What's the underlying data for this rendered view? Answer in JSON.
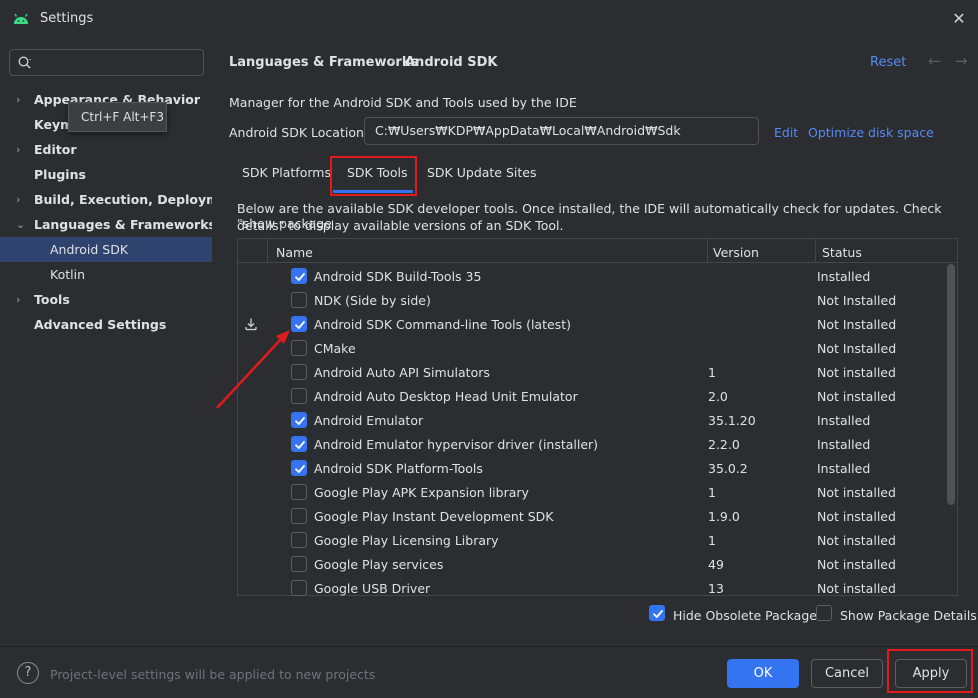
{
  "window": {
    "title": "Settings",
    "close_icon": "close-icon"
  },
  "sidebar": {
    "search_placeholder": "",
    "tooltip": "Ctrl+F Alt+F3",
    "items": [
      {
        "label": "Appearance & Behavior",
        "expandable": true
      },
      {
        "label": "Keymap",
        "expandable": false
      },
      {
        "label": "Editor",
        "expandable": true
      },
      {
        "label": "Plugins",
        "expandable": false
      },
      {
        "label": "Build, Execution, Deployment",
        "expandable": true
      },
      {
        "label": "Languages & Frameworks",
        "expandable": true,
        "expanded": true
      },
      {
        "label": "Android SDK",
        "sub": true,
        "selected": true
      },
      {
        "label": "Kotlin",
        "sub": true
      },
      {
        "label": "Tools",
        "expandable": true
      },
      {
        "label": "Advanced Settings",
        "expandable": false
      }
    ]
  },
  "header": {
    "breadcrumb_1": "Languages & Frameworks",
    "breadcrumb_sep": "›",
    "breadcrumb_2": "Android SDK",
    "reset": "Reset",
    "back": "←",
    "forward": "→"
  },
  "main": {
    "description": "Manager for the Android SDK and Tools used by the IDE",
    "location_label": "Android SDK Location:",
    "location_value": "C:₩Users₩KDP₩AppData₩Local₩Android₩Sdk",
    "edit": "Edit",
    "optimize": "Optimize disk space",
    "tabs": [
      {
        "label": "SDK Platforms"
      },
      {
        "label": "SDK Tools",
        "active": true
      },
      {
        "label": "SDK Update Sites"
      }
    ],
    "hint_line_1": "Below are the available SDK developer tools. Once installed, the IDE will automatically check for updates. Check \"show package",
    "hint_line_2": "details\" to display available versions of an SDK Tool.",
    "table": {
      "columns": [
        "Name",
        "Version",
        "Status"
      ],
      "rows": [
        {
          "checked": true,
          "name": "Android SDK Build-Tools 35",
          "version": "",
          "status": "Installed",
          "download": false
        },
        {
          "checked": false,
          "name": "NDK (Side by side)",
          "version": "",
          "status": "Not Installed",
          "download": false
        },
        {
          "checked": true,
          "name": "Android SDK Command-line Tools (latest)",
          "version": "",
          "status": "Not Installed",
          "download": true
        },
        {
          "checked": false,
          "name": "CMake",
          "version": "",
          "status": "Not Installed",
          "download": false
        },
        {
          "checked": false,
          "name": "Android Auto API Simulators",
          "version": "1",
          "status": "Not installed",
          "download": false
        },
        {
          "checked": false,
          "name": "Android Auto Desktop Head Unit Emulator",
          "version": "2.0",
          "status": "Not installed",
          "download": false
        },
        {
          "checked": true,
          "name": "Android Emulator",
          "version": "35.1.20",
          "status": "Installed",
          "download": false
        },
        {
          "checked": true,
          "name": "Android Emulator hypervisor driver (installer)",
          "version": "2.2.0",
          "status": "Installed",
          "download": false
        },
        {
          "checked": true,
          "name": "Android SDK Platform-Tools",
          "version": "35.0.2",
          "status": "Installed",
          "download": false
        },
        {
          "checked": false,
          "name": "Google Play APK Expansion library",
          "version": "1",
          "status": "Not installed",
          "download": false
        },
        {
          "checked": false,
          "name": "Google Play Instant Development SDK",
          "version": "1.9.0",
          "status": "Not installed",
          "download": false
        },
        {
          "checked": false,
          "name": "Google Play Licensing Library",
          "version": "1",
          "status": "Not installed",
          "download": false
        },
        {
          "checked": false,
          "name": "Google Play services",
          "version": "49",
          "status": "Not installed",
          "download": false
        },
        {
          "checked": false,
          "name": "Google USB Driver",
          "version": "13",
          "status": "Not installed",
          "download": false
        }
      ]
    },
    "hide_obsolete": {
      "label": "Hide Obsolete Packages",
      "checked": true
    },
    "show_details": {
      "label": "Show Package Details",
      "checked": false
    }
  },
  "footer": {
    "help": "?",
    "text": "Project-level settings will be applied to new projects",
    "ok": "OK",
    "cancel": "Cancel",
    "apply": "Apply"
  },
  "colors": {
    "accent": "#3574f0",
    "link": "#548af7",
    "annotation": "#e11b1b",
    "selected_row": "#2e436e"
  }
}
